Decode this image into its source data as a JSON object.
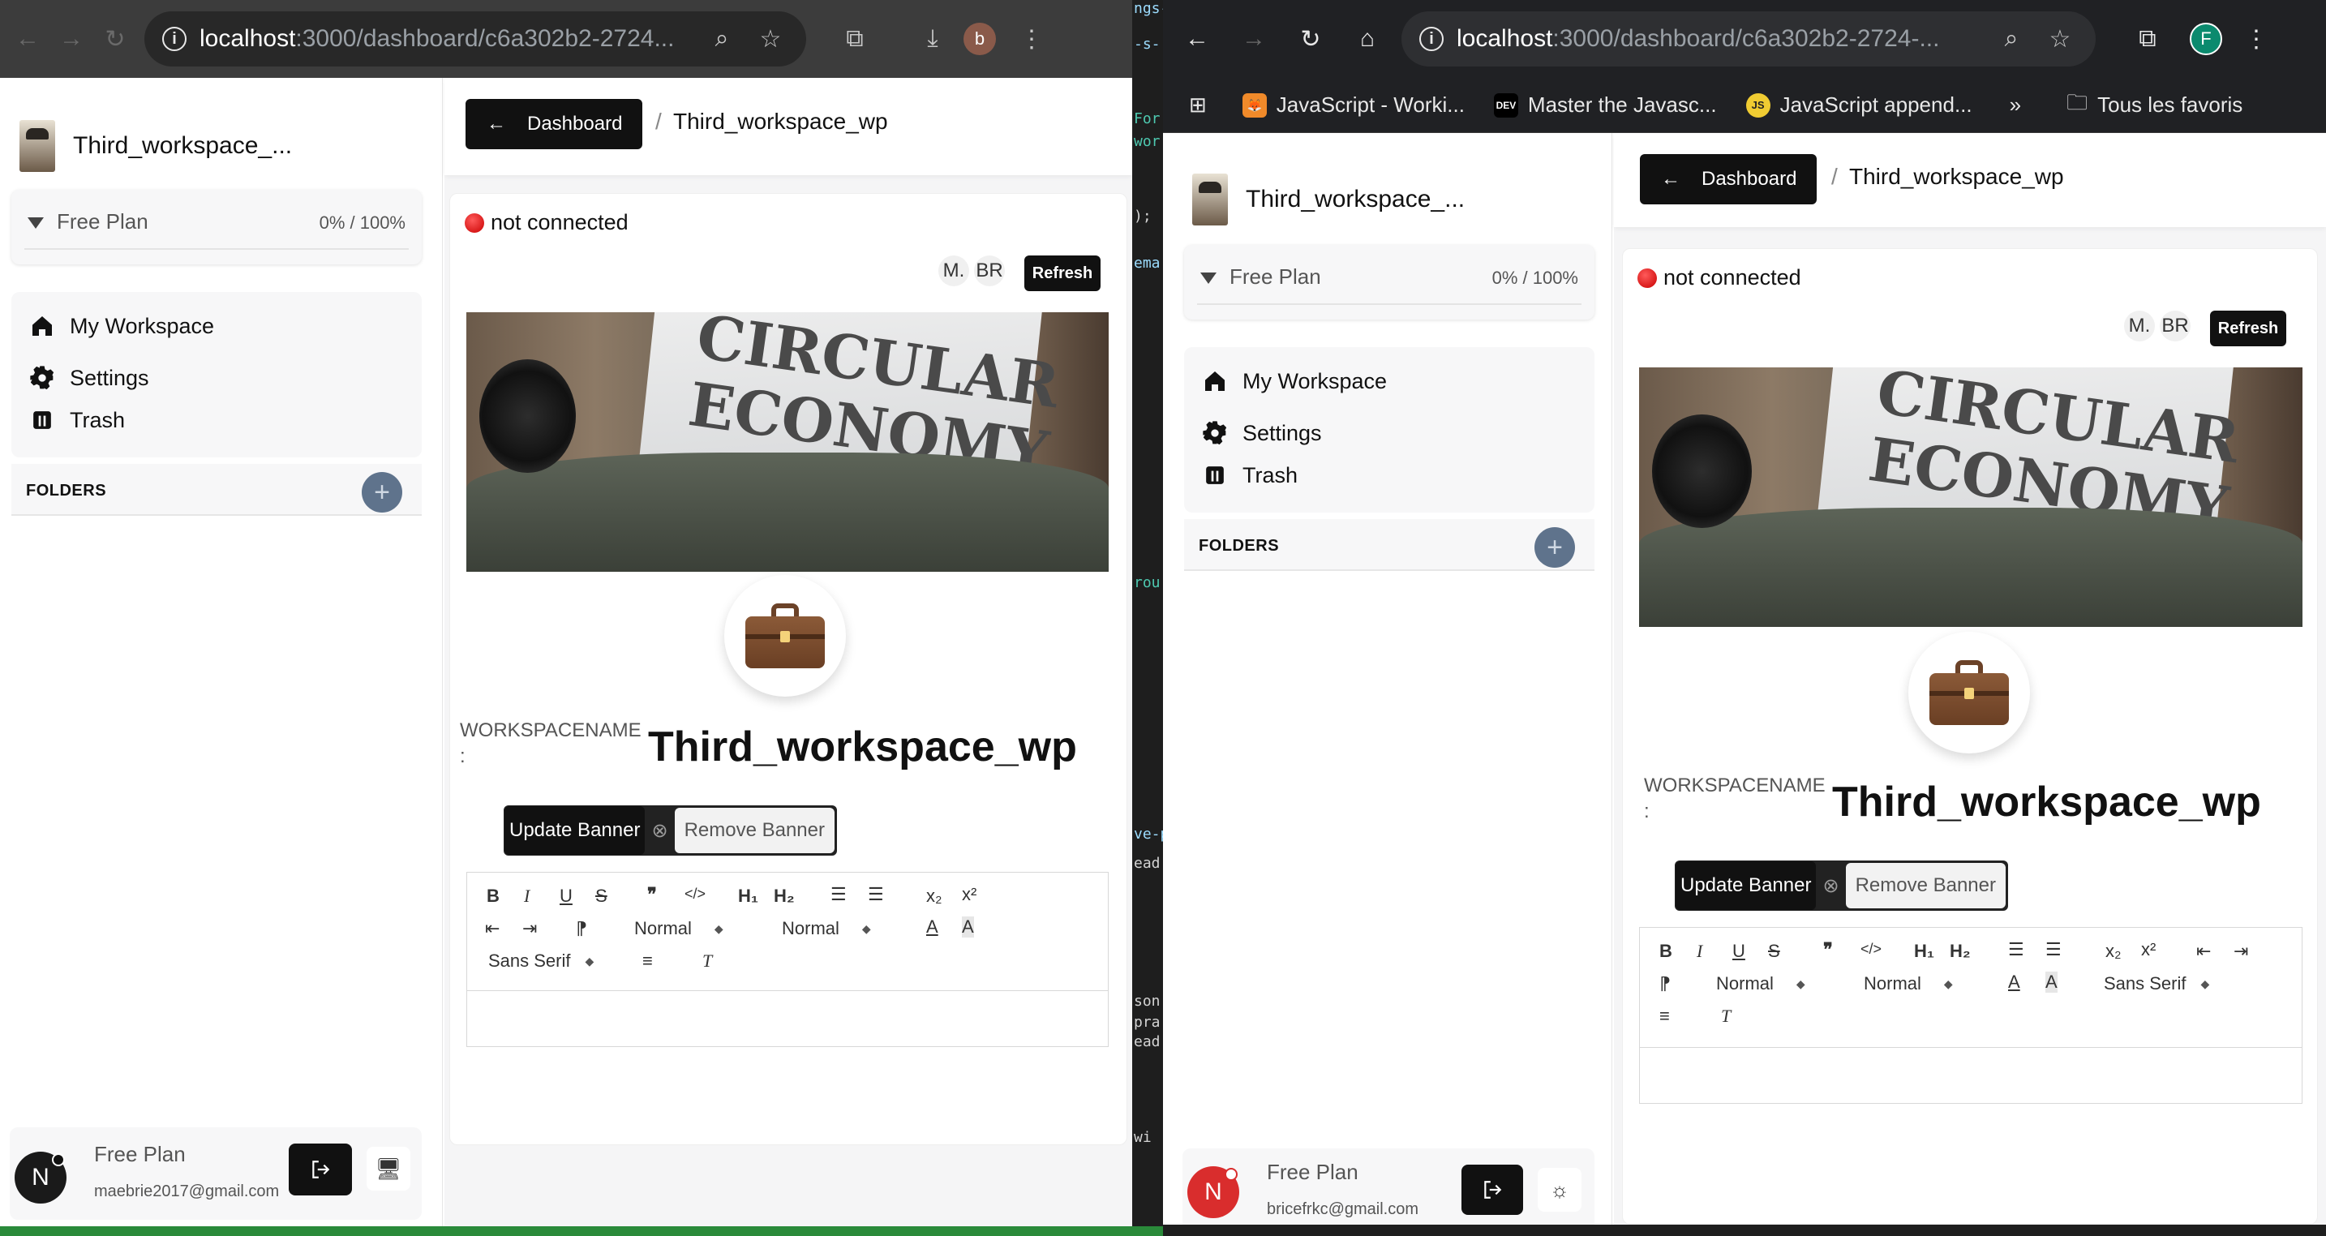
{
  "left_window": {
    "chrome": {
      "url_host": "localhost",
      "url_path": ":3000/dashboard/c6a302b2-2724...",
      "profile_initial": "b",
      "profile_color": "#8a5a4a"
    },
    "workspace_name": "Third_workspace_...",
    "plan": {
      "label": "Free Plan",
      "usage": "0% / 100%"
    },
    "nav": [
      {
        "label": "My Workspace"
      },
      {
        "label": "Settings"
      },
      {
        "label": "Trash"
      }
    ],
    "folders_title": "FOLDERS",
    "user": {
      "plan": "Free Plan",
      "email": "maebrie2017@gmail.com",
      "initial": "N"
    },
    "crumb": {
      "back_label": "Dashboard",
      "separator": "/",
      "current": "Third_workspace_wp"
    },
    "status": "not connected",
    "presence": [
      "M.",
      "BR"
    ],
    "refresh_label": "Refresh",
    "banner_text": [
      "CIRCULAR",
      "ECONOMY"
    ],
    "workspace_label": "WORKSPACENAME",
    "workspace_label_colon": ":",
    "workspace_title": "Third_workspace_wp",
    "update_banner": "Update Banner",
    "remove_banner": "Remove Banner",
    "toolbar": {
      "h1": "H₁",
      "h2": "H₂",
      "sub": "x₂",
      "sup": "x²",
      "size": "Normal",
      "header": "Normal",
      "font": "Sans Serif"
    }
  },
  "right_window": {
    "chrome": {
      "url_host": "localhost",
      "url_path": ":3000/dashboard/c6a302b2-2724-...",
      "profile_initial": "F",
      "profile_color": "#0b8a6e"
    },
    "bookmarks": [
      {
        "label": "JavaScript - Worki...",
        "icon": "firefox-fox-icon",
        "fav_text": "🦊"
      },
      {
        "label": "Master the Javasc...",
        "icon": "dev-icon",
        "fav_text": "DEV"
      },
      {
        "label": "JavaScript append...",
        "icon": "js-icon",
        "fav_text": "JS"
      },
      {
        "label": "Tous les favoris",
        "icon": "folder-icon",
        "fav_text": ""
      }
    ],
    "workspace_name": "Third_workspace_...",
    "plan": {
      "label": "Free Plan",
      "usage": "0% / 100%"
    },
    "nav": [
      {
        "label": "My Workspace"
      },
      {
        "label": "Settings"
      },
      {
        "label": "Trash"
      }
    ],
    "folders_title": "FOLDERS",
    "user": {
      "plan": "Free Plan",
      "email": "bricefrkc@gmail.com",
      "initial": "N"
    },
    "crumb": {
      "back_label": "Dashboard",
      "separator": "/",
      "current": "Third_workspace_wp"
    },
    "status": "not connected",
    "presence": [
      "M.",
      "BR"
    ],
    "refresh_label": "Refresh",
    "banner_text": [
      "CIRCULAR",
      "ECONOMY"
    ],
    "workspace_label": "WORKSPACENAME",
    "workspace_label_colon": ":",
    "workspace_title": "Third_workspace_wp",
    "update_banner": "Update Banner",
    "remove_banner": "Remove Banner",
    "toolbar": {
      "h1": "H₁",
      "h2": "H₂",
      "sub": "x₂",
      "sup": "x²",
      "size": "Normal",
      "header": "Normal",
      "font": "Sans Serif"
    }
  },
  "background_code": [
    "ngs-",
    "-s-",
    "For",
    "wor",
    ");",
    "ema",
    "rou",
    "ve-p",
    "ead",
    "son",
    "pra",
    "ead",
    "wi"
  ],
  "colors": {
    "accent_dark": "#111111",
    "status_red": "#d21f1f",
    "folder_add": "#5f738c",
    "user_avatar_red": "#d92d2d",
    "user_avatar_dark": "#1a1a1a"
  }
}
